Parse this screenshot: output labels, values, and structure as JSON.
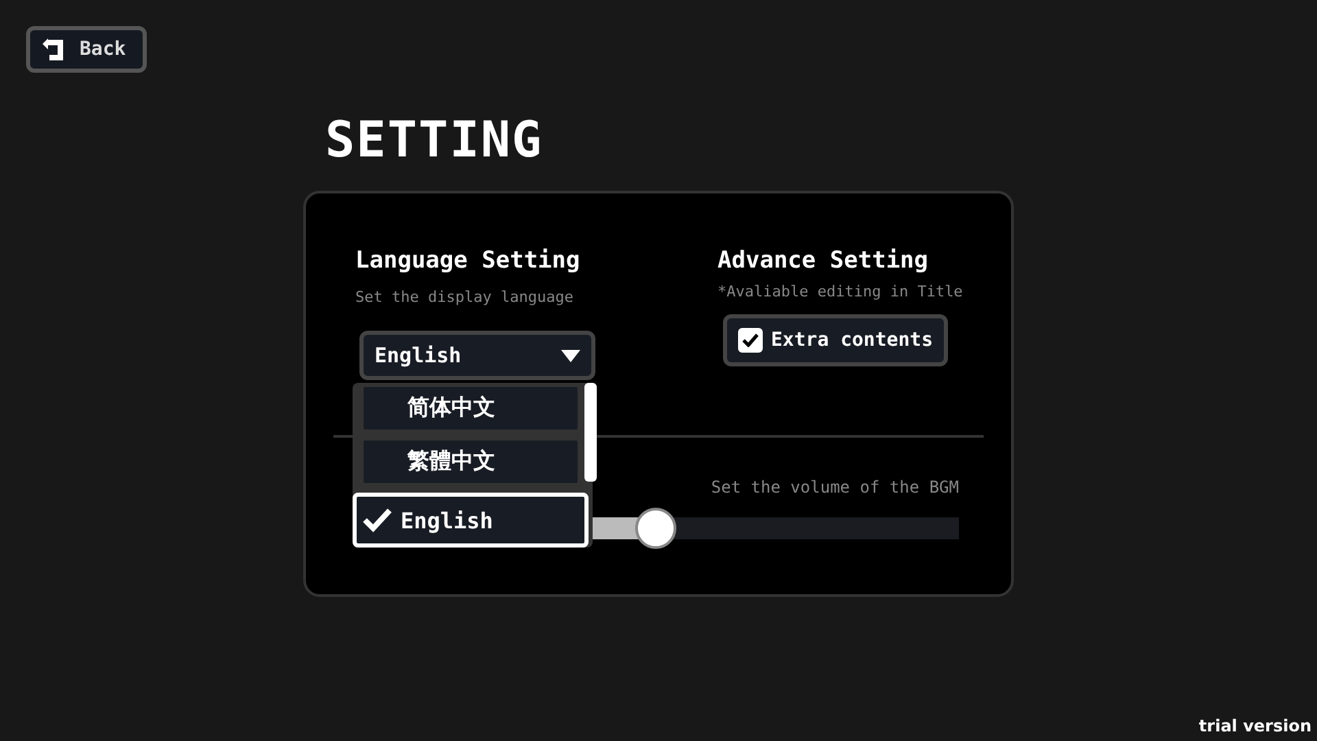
{
  "back_button": {
    "label": "Back"
  },
  "title": "SETTING",
  "language": {
    "heading": "Language Setting",
    "description": "Set the display language",
    "value": "English",
    "expanded": true,
    "options": [
      {
        "label": "简体中文",
        "selected": false
      },
      {
        "label": "繁體中文",
        "selected": false
      },
      {
        "label": "English",
        "selected": true
      }
    ]
  },
  "advance": {
    "heading": "Advance Setting",
    "description": "*Avaliable editing in Title",
    "checkbox": {
      "label": "Extra contents",
      "checked": true
    }
  },
  "bgm": {
    "description": "Set the volume of the BGM",
    "level": 0.5
  },
  "footer": "trial version"
}
